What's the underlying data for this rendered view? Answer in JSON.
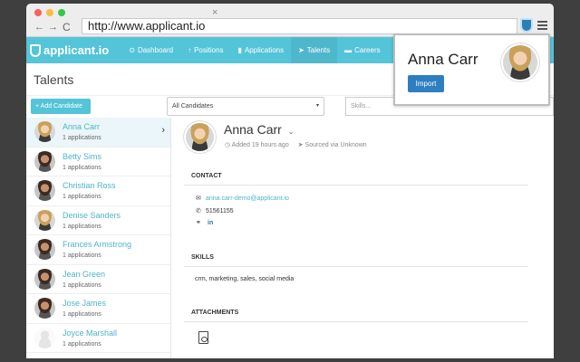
{
  "browser": {
    "url": "http://www.applicant.io",
    "tab_close": "×",
    "back": "←",
    "forward": "→",
    "reload": "C"
  },
  "nav": {
    "brand": "applicant.io",
    "items": [
      {
        "label": "Dashboard",
        "icon": "⊙"
      },
      {
        "label": "Positions",
        "icon": "↑"
      },
      {
        "label": "Applications",
        "icon": "▮"
      },
      {
        "label": "Talents",
        "icon": "➤"
      },
      {
        "label": "Careers",
        "icon": "▬"
      }
    ],
    "active_item": "Talents"
  },
  "page": {
    "title": "Talents",
    "add_button": "+ Add Candidate",
    "filter_select": "All Candidates",
    "filter_caret": "▾",
    "skills_placeholder": "Skills..."
  },
  "candidates": [
    {
      "name": "Anna Carr",
      "sub": "1 applications",
      "avatar": "light"
    },
    {
      "name": "Betty Sims",
      "sub": "1 applications",
      "avatar": "dark"
    },
    {
      "name": "Christian Ross",
      "sub": "1 applications",
      "avatar": "dark"
    },
    {
      "name": "Denise Sanders",
      "sub": "1 applications",
      "avatar": "light"
    },
    {
      "name": "Frances Armstrong",
      "sub": "1 applications",
      "avatar": "dark"
    },
    {
      "name": "Jean Green",
      "sub": "1 applications",
      "avatar": "dark"
    },
    {
      "name": "Jose James",
      "sub": "1 applications",
      "avatar": "dark"
    },
    {
      "name": "Joyce Marshall",
      "sub": "1 applications",
      "avatar": "placeholder"
    }
  ],
  "detail": {
    "name": "Anna Carr",
    "name_caret": "⌄",
    "added": "Added 19 hours ago",
    "source": "Sourced via Unknown",
    "contact_heading": "CONTACT",
    "email": "anna.carr-demo@applicant.io",
    "phone": "51561155",
    "linkedin": "in",
    "skills_heading": "SKILLS",
    "skills": "crm, marketing, sales, social media",
    "attachments_heading": "ATTACHMENTS"
  },
  "popup": {
    "name": "Anna Carr",
    "import_button": "Import"
  },
  "colors": {
    "accent": "#54c4d8",
    "link": "#4eb4c8",
    "import": "#2f7ec1"
  }
}
